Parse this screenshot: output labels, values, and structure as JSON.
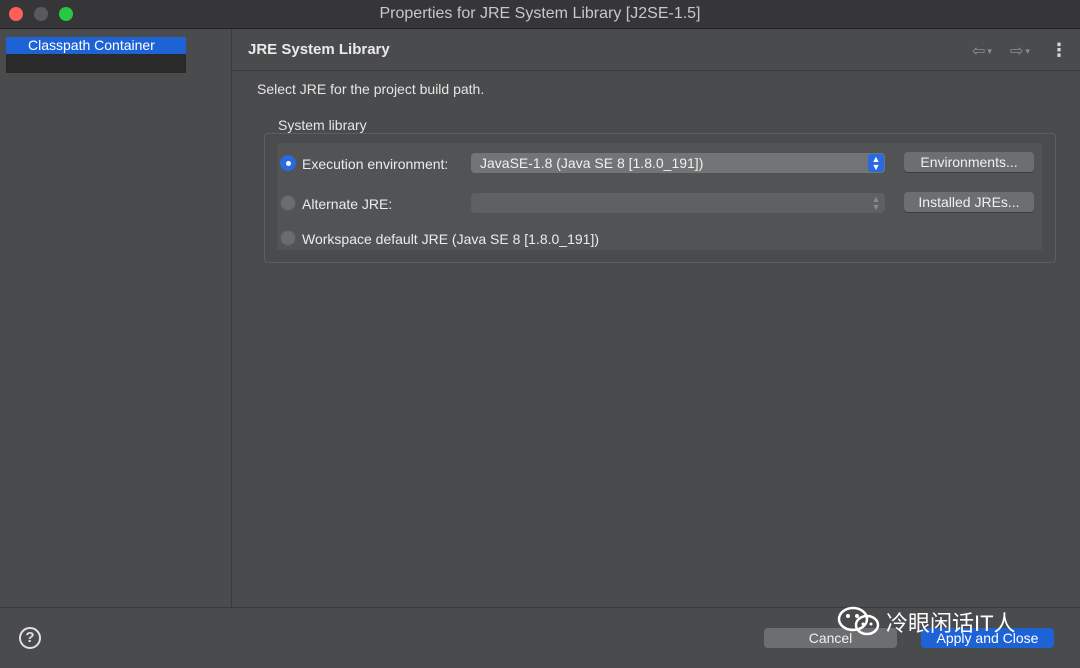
{
  "window": {
    "title": "Properties for JRE System Library [J2SE-1.5]"
  },
  "sidebar": {
    "items": [
      {
        "label": "Classpath Container",
        "selected": true
      }
    ]
  },
  "header": {
    "title": "JRE System Library"
  },
  "main": {
    "description": "Select JRE for the project build path.",
    "group_label": "System library",
    "options": [
      {
        "label": "Execution environment:",
        "selected": true,
        "combo_value": "JavaSE-1.8 (Java SE 8 [1.8.0_191])",
        "button": "Environments..."
      },
      {
        "label": "Alternate JRE:",
        "selected": false,
        "combo_value": "",
        "button": "Installed JREs..."
      },
      {
        "label": "Workspace default JRE (Java SE 8 [1.8.0_191])",
        "selected": false
      }
    ]
  },
  "footer": {
    "help": "?",
    "cancel": "Cancel",
    "apply": "Apply and Close"
  },
  "watermark": {
    "text": "冷眼闲话IT人"
  },
  "colors": {
    "accent": "#1e63d6",
    "background": "#4a4b4d"
  },
  "icons": [
    "help-icon",
    "back-arrow-icon",
    "forward-arrow-icon",
    "view-menu-icon",
    "wechat-logo-icon"
  ]
}
